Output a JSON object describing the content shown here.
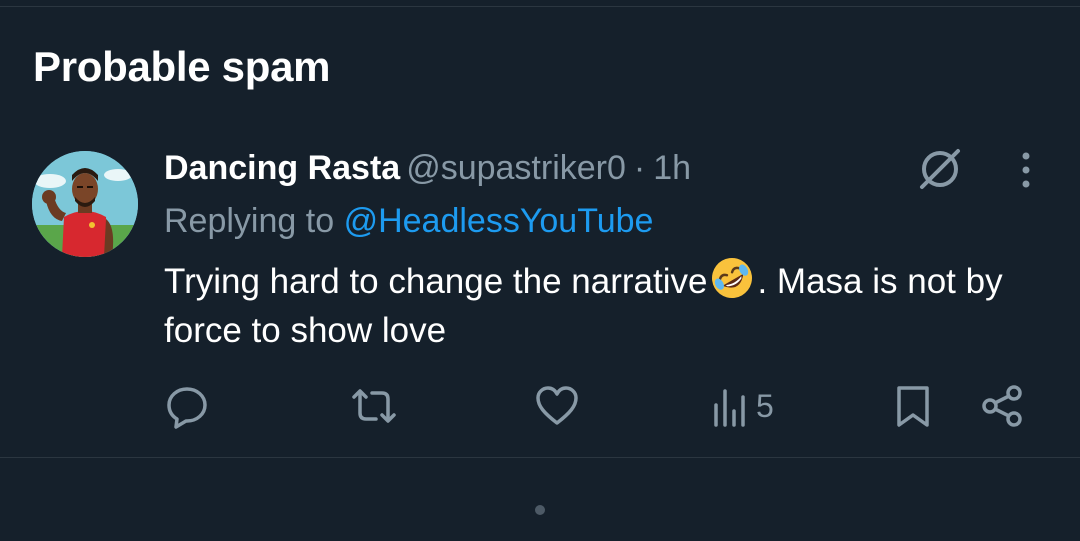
{
  "section": {
    "title": "Probable spam"
  },
  "post": {
    "author": {
      "display_name": "Dancing Rasta",
      "handle": "@supastriker0",
      "avatar_icon": "avatar-icon"
    },
    "separator": "·",
    "time": "1h",
    "replying_to_label": "Replying to",
    "replying_to_handle": "@HeadlessYouTube",
    "text_before_emoji": "Trying hard to change the narrative",
    "emoji_name": "rolling-on-floor-laughing",
    "text_after_emoji": ". Masa is not by force to show love",
    "actions": {
      "reply_icon": "reply-icon",
      "repost_icon": "repost-icon",
      "like_icon": "like-icon",
      "views_icon": "views-icon",
      "views_count": "5",
      "bookmark_icon": "bookmark-icon",
      "share_icon": "share-icon"
    }
  },
  "colors": {
    "background": "#15202b",
    "secondary_text": "#8899a6",
    "accent": "#1d9bf0",
    "divider": "#2b3640"
  }
}
